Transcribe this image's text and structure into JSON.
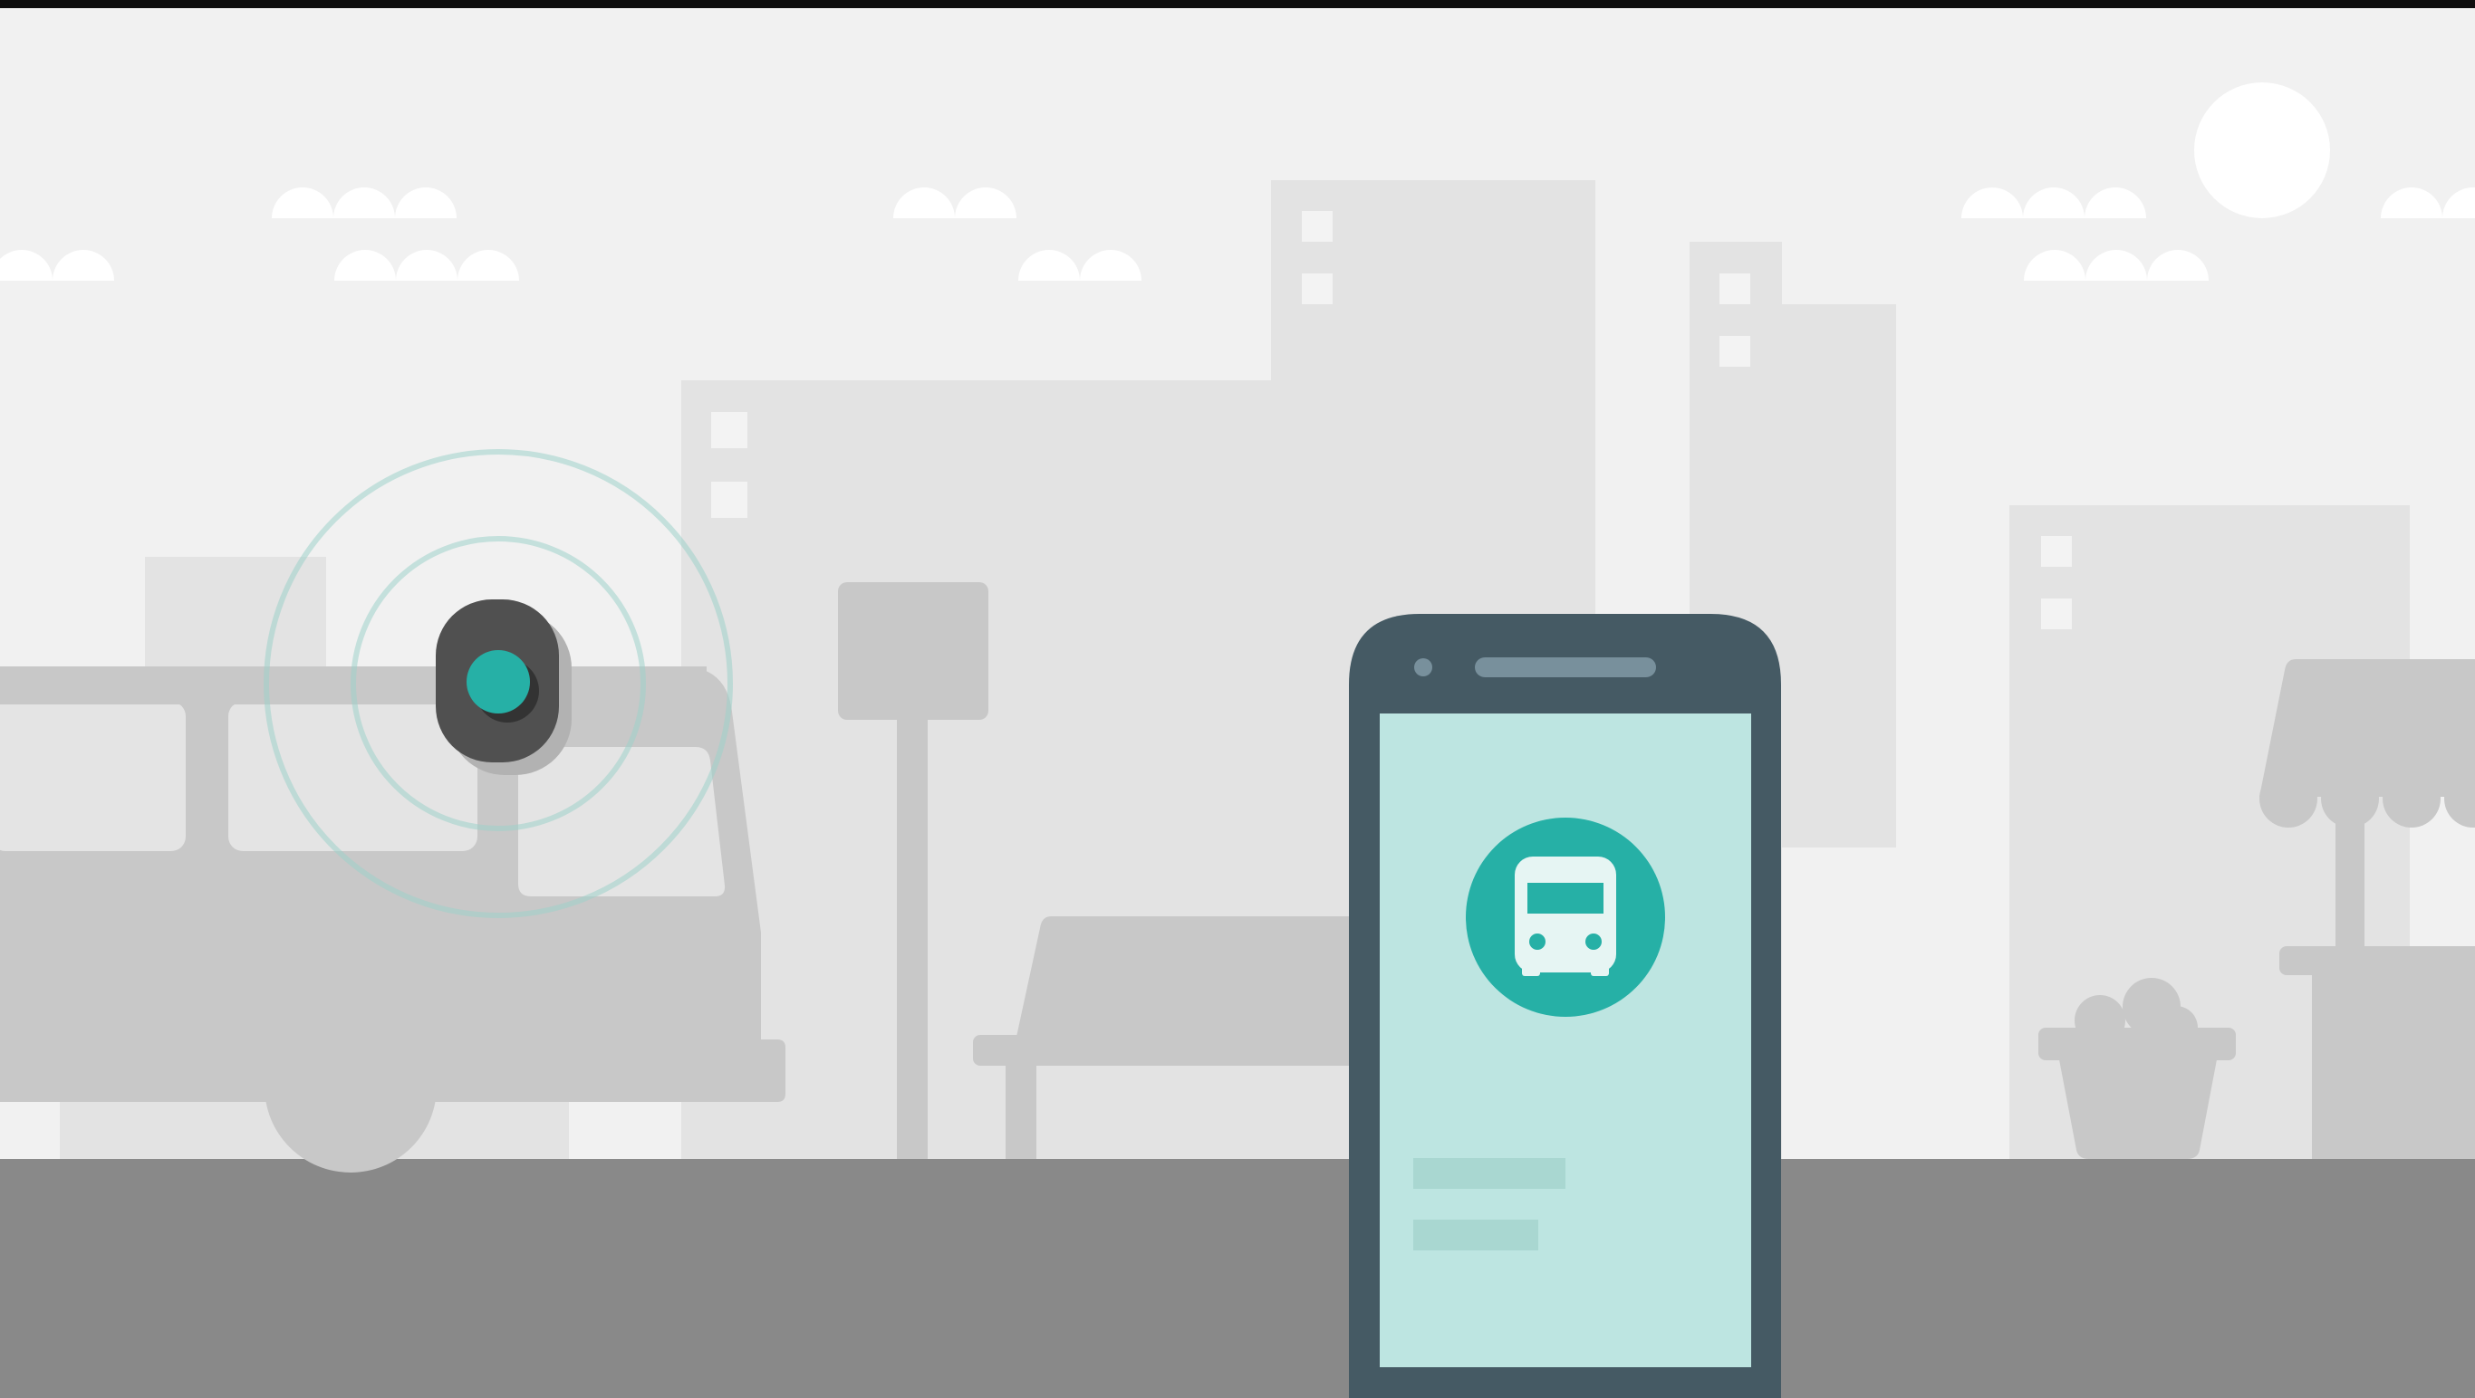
{
  "scene": {
    "icons": {
      "sun": "sun-icon",
      "cloud": "cloud-icon",
      "beacon": "bluetooth-beacon-icon",
      "bus": "bus-icon",
      "smartphone": "smartphone-icon"
    },
    "colors": {
      "top_bar": "#0e0e0e",
      "sky": "#f1f1f1",
      "cloud": "#ffffff",
      "building": "#e3e3e3",
      "building_window": "#f3f3f3",
      "foreground_object": "#c8c8c8",
      "ground": "#898989",
      "phone_body": "#455a64",
      "phone_speaker": "#78909c",
      "phone_screen": "#bde5e1",
      "accent": "#26b0a6",
      "screen_placeholder": "#a9d7d1",
      "beacon_body": "#505050",
      "beacon_ring": "#9fd1cb"
    }
  }
}
